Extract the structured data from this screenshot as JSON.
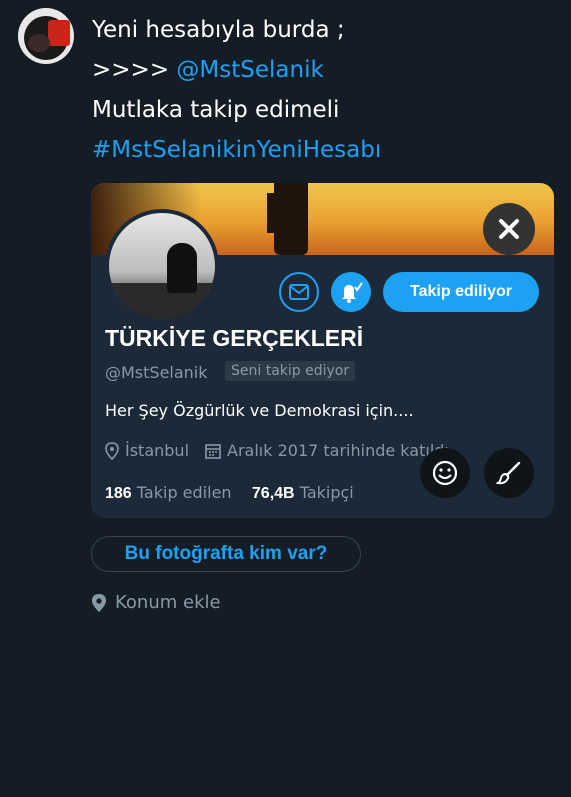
{
  "tweet": {
    "line1": "Yeni hesabıyla burda ;",
    "line2_prefix": ">>>> ",
    "line2_mention": "@MstSelanik",
    "line3": "Mutlaka takip edimeli",
    "line4_hashtag": "#MstSelanikinYeniHesabı"
  },
  "card": {
    "follow_label": "Takip ediliyor",
    "name": "TÜRKİYE GERÇEKLERİ",
    "handle": "@MstSelanik",
    "follows_you": "Seni takip ediyor",
    "bio": "Her Şey Özgürlük ve Demokrasi için....",
    "location": "İstanbul",
    "joined": "Aralık 2017 tarihinde katıldı",
    "following_count": "186",
    "following_label": "Takip edilen",
    "followers_count": "76,4B",
    "followers_label": "Takipçi"
  },
  "actions": {
    "tag_people": "Bu fotoğrafta kim var?",
    "add_location": "Konum ekle"
  },
  "colors": {
    "background": "#141d26",
    "accent": "#1da1f2",
    "card": "#1c2938",
    "muted": "#8899a6"
  },
  "icons": [
    "close-icon",
    "mail-icon",
    "bell-check-icon",
    "location-pin-icon",
    "calendar-icon",
    "smiley-icon",
    "brush-icon"
  ]
}
